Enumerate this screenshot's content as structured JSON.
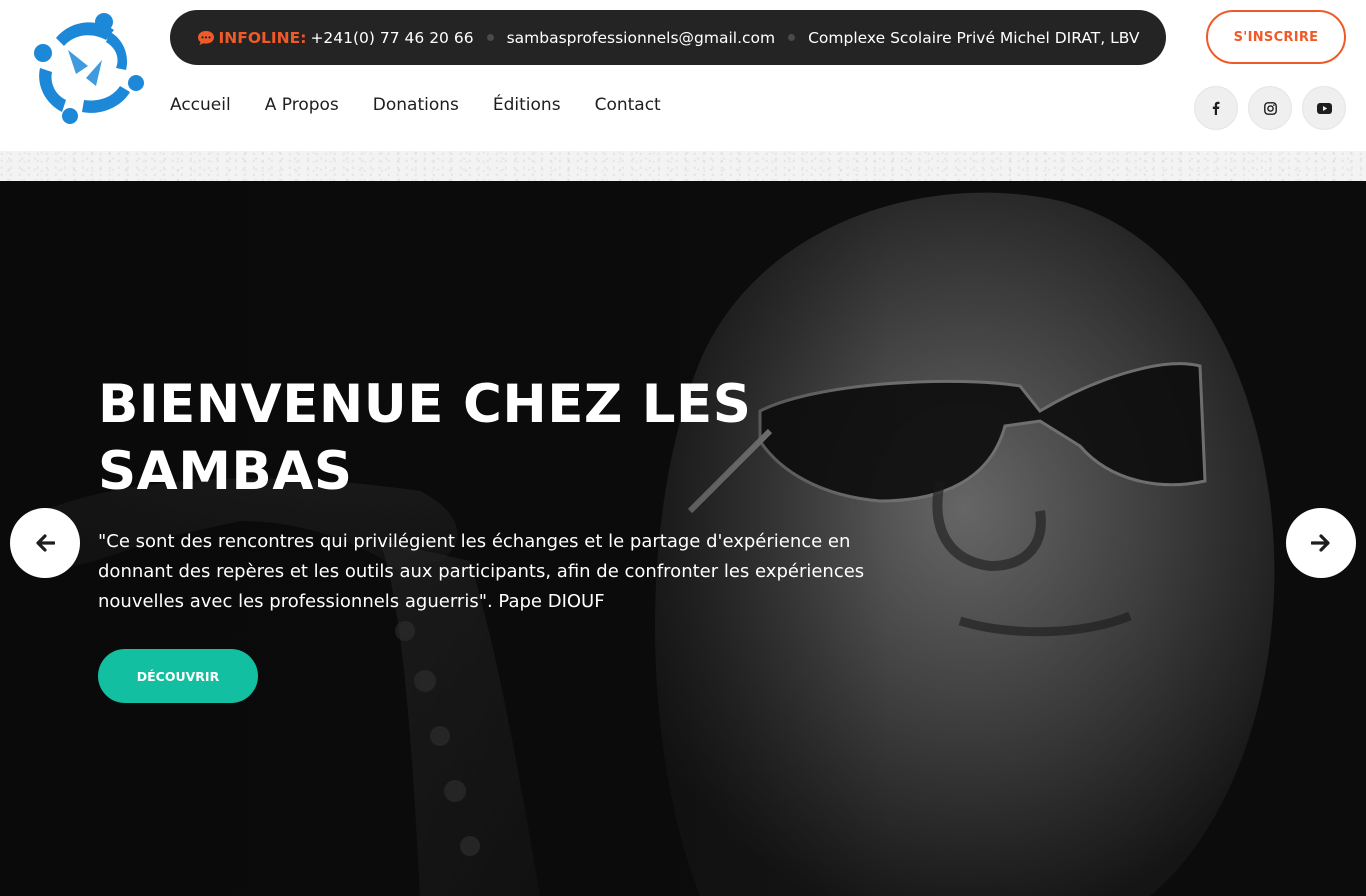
{
  "brand": {
    "logo_icon": "people-circle-logo-icon",
    "logo_color": "#1e88d8"
  },
  "topbar": {
    "info_icon": "chat-bubble-icon",
    "info_label": "INFOLINE:",
    "phone": "+241(0) 77 46 20 66",
    "email": "sambasprofessionnels@gmail.com",
    "address": "Complexe Scolaire Privé Michel DIRAT, LBV"
  },
  "signup_label": "S'INSCRIRE",
  "nav": {
    "items": [
      "Accueil",
      "A Propos",
      "Donations",
      "Éditions",
      "Contact"
    ]
  },
  "socials": [
    "facebook-icon",
    "instagram-icon",
    "youtube-icon"
  ],
  "hero": {
    "title": "BIENVENUE CHEZ LES SAMBAS",
    "quote": "\"Ce sont des rencontres qui privilégient les échanges et le partage d'expérience en donnant des repères et les outils aux participants, afin de confronter les expériences nouvelles avec les professionnels aguerris\". Pape DIOUF",
    "cta_label": "DÉCOUVRIR",
    "prev_icon": "arrow-left-icon",
    "next_icon": "arrow-right-icon"
  },
  "colors": {
    "accent_orange": "#f05a28",
    "accent_teal": "#12bfa1",
    "topbar_bg": "#242424",
    "hero_bg": "#0c0c0c"
  }
}
